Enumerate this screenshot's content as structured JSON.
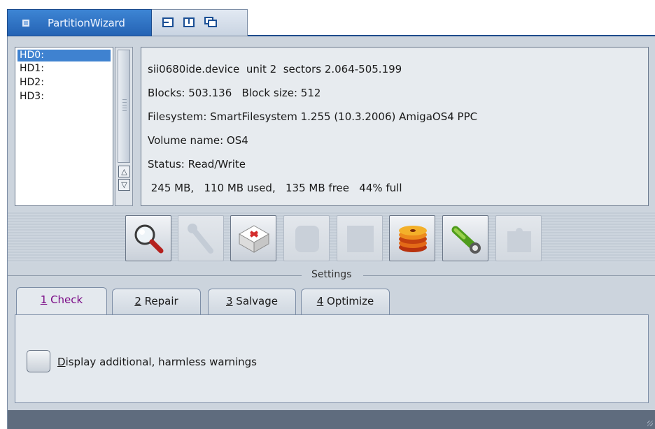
{
  "window": {
    "title": "PartitionWizard",
    "gadgets": [
      "iconify-icon",
      "zoom-icon",
      "depth-icon"
    ]
  },
  "devices": {
    "items": [
      "HD0:",
      "HD1:",
      "HD2:",
      "HD3:"
    ],
    "selected": "HD0:"
  },
  "info": {
    "line1": "sii0680ide.device  unit 2  sectors 2.064-505.199",
    "line2": "Blocks: 503.136   Block size: 512",
    "line3": "Filesystem: SmartFilesystem 1.255 (10.3.2006) AmigaOS4 PPC",
    "line4": "Volume name: OS4",
    "line5": "Status: Read/Write",
    "line6": " 245 MB,   110 MB used,   135 MB free   44% full"
  },
  "toolbar": {
    "buttons": [
      {
        "icon": "magnifier-icon",
        "enabled": true
      },
      {
        "icon": "wrench-icon",
        "enabled": false
      },
      {
        "icon": "first-aid-kit-icon",
        "enabled": true
      },
      {
        "icon": "salvage-icon",
        "enabled": false
      },
      {
        "icon": "blank-icon",
        "enabled": false
      },
      {
        "icon": "disk-stack-icon",
        "enabled": true
      },
      {
        "icon": "flashlight-icon",
        "enabled": true
      },
      {
        "icon": "puzzle-icon",
        "enabled": false
      }
    ]
  },
  "settings": {
    "group_title": "Settings",
    "tabs": [
      {
        "num": "1",
        "label": " Check"
      },
      {
        "num": "2",
        "label": " Repair"
      },
      {
        "num": "3",
        "label": " Salvage"
      },
      {
        "num": "4",
        "label": " Optimize"
      }
    ],
    "active_tab": "1 Check",
    "checkbox": {
      "first": "D",
      "rest": "isplay additional, harmless warnings",
      "checked": false
    }
  },
  "colors": {
    "title_active": "#2f74c4",
    "selection": "#3f82d0",
    "active_tab_text": "#7a0a86",
    "window_bg": "#ccd4dd",
    "statusbar": "#5f6c7e"
  }
}
